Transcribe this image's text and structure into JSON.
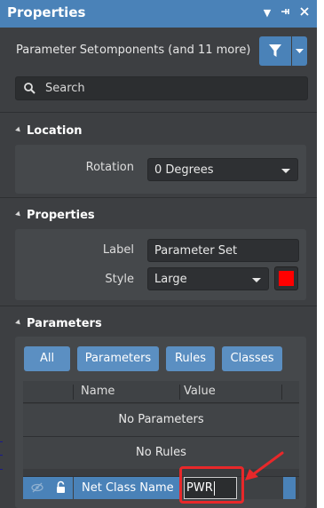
{
  "window": {
    "title": "Properties",
    "buttons": [
      "dropdown-icon",
      "pin-icon",
      "close-icon"
    ]
  },
  "selection": {
    "label": "Parameter Set",
    "value": "Components (and 11 more)",
    "visible_value": "omponents (and 11 more)"
  },
  "search": {
    "placeholder": "Search"
  },
  "location": {
    "heading": "Location",
    "rotation_label": "Rotation",
    "rotation_value": "0 Degrees"
  },
  "properties": {
    "heading": "Properties",
    "label_label": "Label",
    "label_value": "Parameter Set",
    "style_label": "Style",
    "style_value": "Large",
    "color": "#ff0000"
  },
  "parameters": {
    "heading": "Parameters",
    "filters": [
      "All",
      "Parameters",
      "Rules",
      "Classes"
    ],
    "columns": {
      "name": "Name",
      "value": "Value"
    },
    "no_parameters": "No Parameters",
    "no_rules": "No Rules",
    "row": {
      "name": "Net Class Name",
      "value": "PWR"
    }
  },
  "colors": {
    "accent": "#4a82b8",
    "panel_bg": "#3d3f42",
    "highlight": "#e8282a"
  }
}
